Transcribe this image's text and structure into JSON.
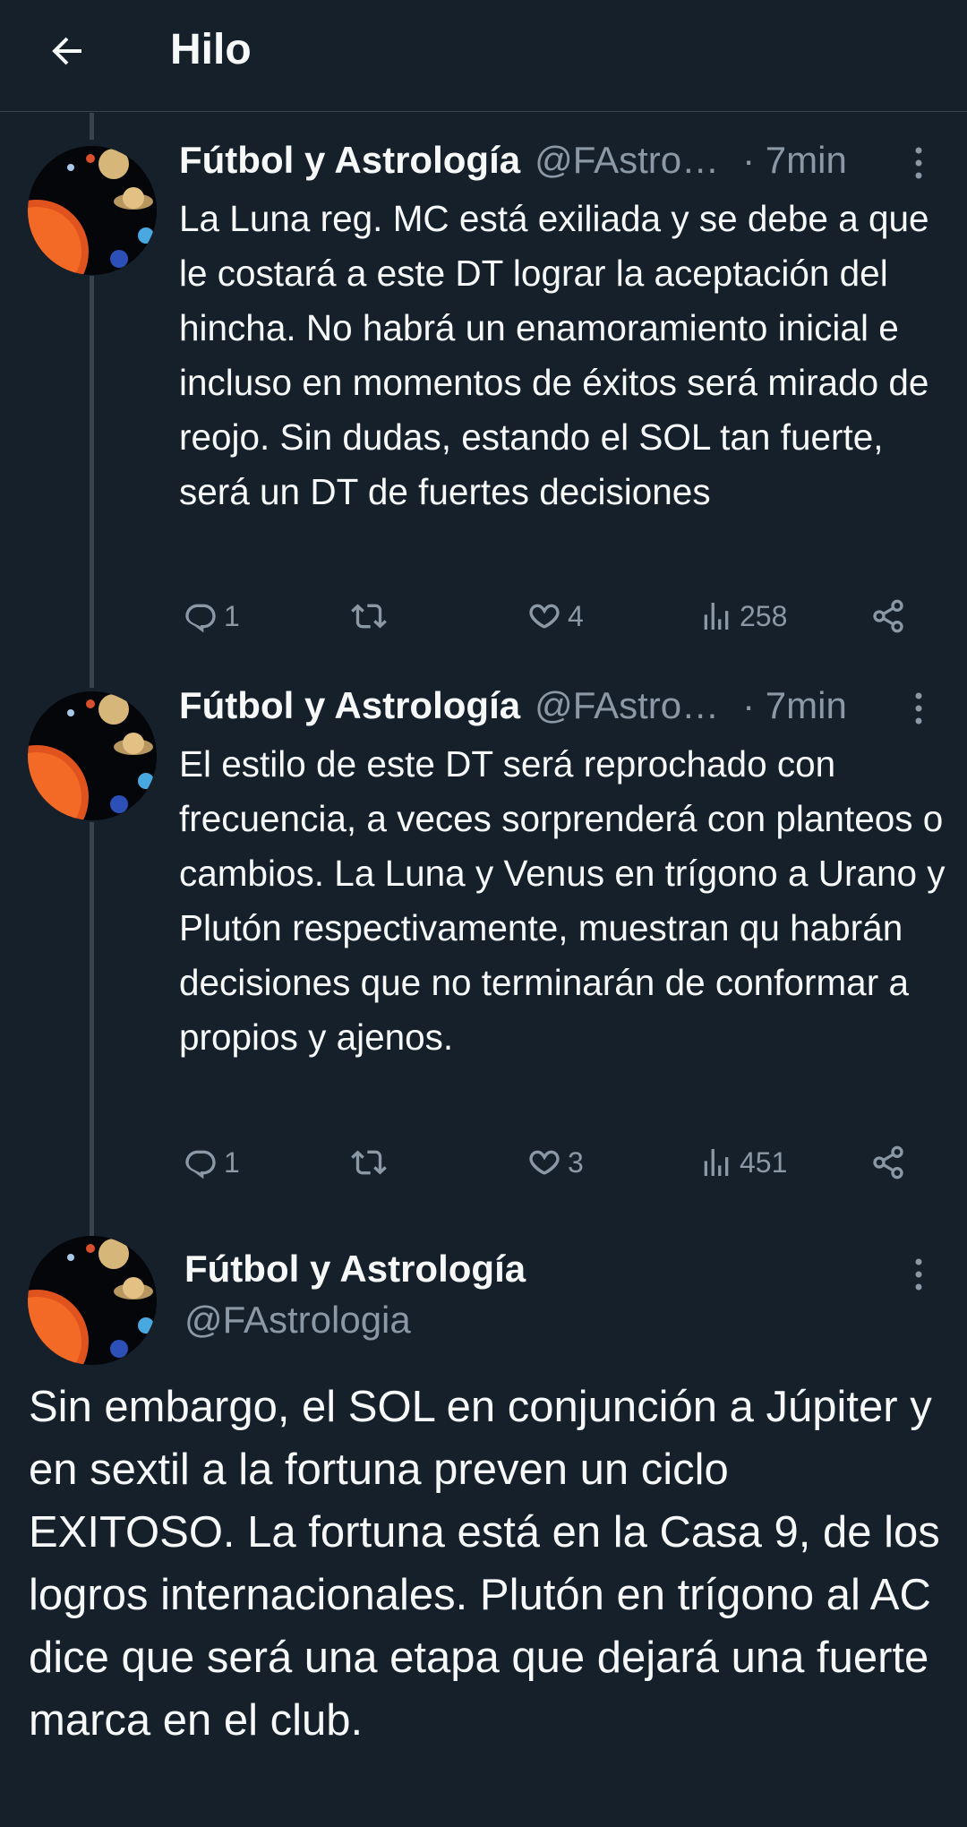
{
  "header": {
    "title": "Hilo",
    "back_icon": "arrow-left-icon"
  },
  "colors": {
    "background": "#15202b",
    "text": "#f7f9f9",
    "secondary": "#8b98a5",
    "divider": "#38444d"
  },
  "tweets": [
    {
      "author_name": "Fútbol y Astrología",
      "handle": "@FAstrologia",
      "time": "· 7min",
      "text": "La Luna reg. MC está exiliada y se debe a que le costará a este DT lograr la aceptación del hincha. No habrá un enamoramiento inicial e incluso en momentos de éxitos será mirado de reojo. Sin dudas, estando el SOL tan fuerte, será un DT de fuertes decisiones",
      "replies": "1",
      "retweets": "",
      "likes": "4",
      "views": "258"
    },
    {
      "author_name": "Fútbol y Astrología",
      "handle": "@FAstrologia",
      "time": "· 7min",
      "text": "El estilo de este DT será reprochado con frecuencia, a veces sorprenderá con planteos o cambios. La Luna y Venus en trígono a Urano y Plutón respectivamente, muestran qu habrán decisiones que no terminarán de conformar a propios y ajenos.",
      "replies": "1",
      "retweets": "",
      "likes": "3",
      "views": "451"
    }
  ],
  "main_tweet": {
    "author_name": "Fútbol y Astrología",
    "handle": "@FAstrologia",
    "text": "Sin embargo, el SOL en conjunción a Júpiter y en sextil a la fortuna preven un ciclo EXITOSO. La fortuna está en la Casa 9, de los logros internacionales. Plutón en trígono al AC dice que será una etapa que dejará una fuerte marca en el club."
  }
}
